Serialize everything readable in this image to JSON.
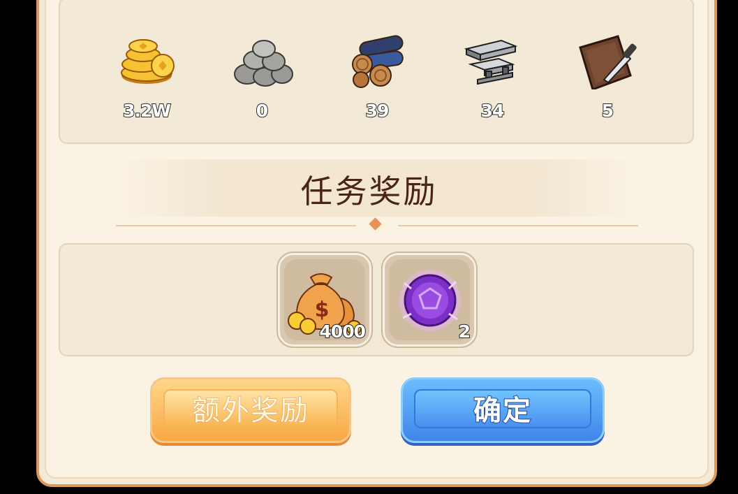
{
  "resources": [
    {
      "icon": "gold-coins-icon",
      "value": "3.2W"
    },
    {
      "icon": "stone-pile-icon",
      "value": "0"
    },
    {
      "icon": "wood-logs-icon",
      "value": "39"
    },
    {
      "icon": "iron-beams-icon",
      "value": "34"
    },
    {
      "icon": "leather-knife-icon",
      "value": "5"
    }
  ],
  "section_title": "任务奖励",
  "rewards": [
    {
      "icon": "money-bag-icon",
      "count": "4000"
    },
    {
      "icon": "purple-orb-icon",
      "count": "2"
    }
  ],
  "buttons": {
    "extra_label": "额外奖励",
    "confirm_label": "确定"
  },
  "colors": {
    "panel_border": "#d99a5c",
    "title_text": "#4a2416",
    "accent_orange": "#f7a843",
    "accent_blue": "#3f86ea"
  }
}
